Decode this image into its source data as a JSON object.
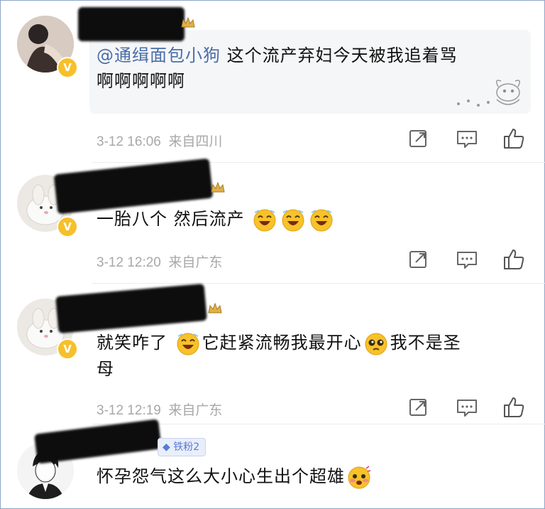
{
  "comments": [
    {
      "mention": "@通缉面包小狗",
      "text_line1": " 这个流产弃妇今天被我追着骂",
      "text_line2": "啊啊啊啊啊",
      "time": "3-12 16:06",
      "location": "来自四川"
    },
    {
      "text": "一胎八个 然后流产",
      "time": "3-12 12:20",
      "location": "来自广东"
    },
    {
      "text_a": "就笑咋了 ",
      "text_b": "它赶紧流畅我最开心",
      "text_c": "我不是圣",
      "text_line2": "母",
      "time": "3-12 12:19",
      "location": "来自广东"
    },
    {
      "badge": "铁粉2",
      "text": "怀孕怨气这么大小心生出个超雄"
    }
  ],
  "icons": [
    "share-icon",
    "comment-icon",
    "like-icon",
    "verified-badge-icon",
    "laughing-emoji-icon",
    "pleading-emoji-icon",
    "blushing-emoji-icon"
  ],
  "colors": {
    "mention": "#4a6ea8",
    "meta": "#a8a8a8",
    "verified": "#f7c02a",
    "fan_badge": "#5a7bd6"
  }
}
